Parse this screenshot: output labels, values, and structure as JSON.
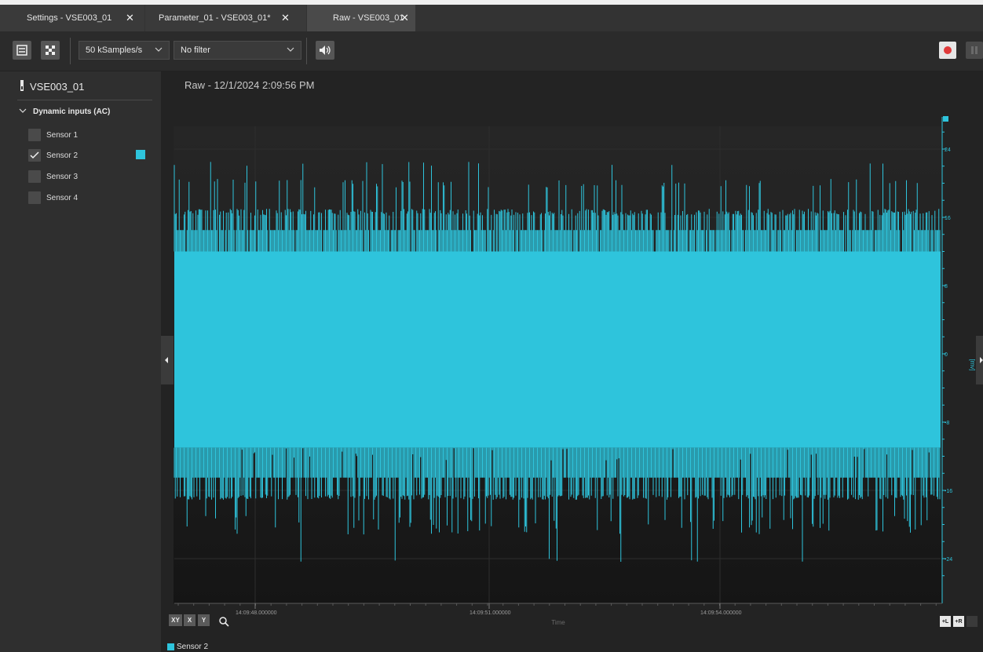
{
  "tabs": [
    {
      "label": "Settings - VSE003_01",
      "close": "✕"
    },
    {
      "label": "Parameter_01 - VSE003_01*",
      "close": "✕"
    },
    {
      "label": "Raw - VSE003_01",
      "close": "✕"
    }
  ],
  "toolbar": {
    "sample_rate": "50 kSamples/s",
    "filter": "No filter",
    "icons": [
      "dashboard-icon",
      "checker-icon",
      "speaker-icon",
      "record-icon",
      "pause-icon"
    ]
  },
  "sidebar": {
    "device": "VSE003_01",
    "group": "Dynamic inputs (AC)",
    "sensors": [
      {
        "label": "Sensor 1",
        "checked": false
      },
      {
        "label": "Sensor 2",
        "checked": true
      },
      {
        "label": "Sensor 3",
        "checked": false
      },
      {
        "label": "Sensor 4",
        "checked": false
      }
    ]
  },
  "chart": {
    "title": "Raw - 12/1/2024 2:09:56 PM",
    "axis_buttons": [
      "XY",
      "X",
      "Y"
    ],
    "corner_buttons": [
      "+L",
      "+R"
    ],
    "legend": "Sensor 2"
  },
  "colors": {
    "series": "#2ec4dc",
    "record": "#e03a3a"
  },
  "chart_data": {
    "type": "line",
    "title": "",
    "xlabel": "Time",
    "ylabel": "[mv]",
    "x_ticks": [
      "14:09:48.000000",
      "14:09:51.000000",
      "14:09:54.000000"
    ],
    "y_ticks": [
      24,
      16,
      8,
      0,
      -8,
      -16,
      -24
    ],
    "ylim": [
      -28,
      26
    ],
    "series": [
      {
        "name": "Sensor 2",
        "color": "#2ec4dc",
        "band_core": [
          -11,
          12
        ],
        "band_dense": [
          -14.5,
          14.5
        ],
        "typical_envelope": [
          -17,
          17
        ],
        "spike_min": -24.5,
        "spike_max": 22.5
      }
    ],
    "grid": true,
    "legend": "bottom-left"
  }
}
